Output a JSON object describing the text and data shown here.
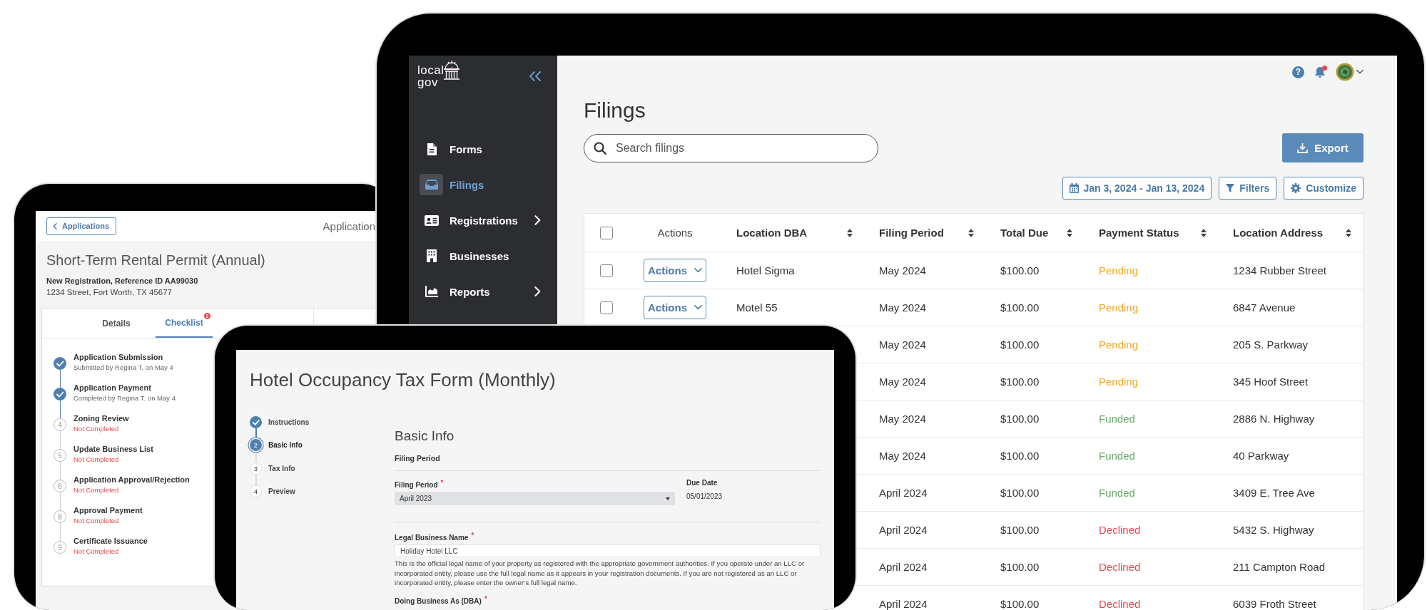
{
  "permit_app": {
    "back_button": "Applications",
    "header_title": "Application",
    "title": "Short-Term Rental Permit (Annual)",
    "subtitle": "New Registration, Reference ID AA99030",
    "address": "1234 Street, Fort Worth, TX 45677",
    "tabs": [
      {
        "label": "Details",
        "selected": false
      },
      {
        "label": "Checklist",
        "selected": true,
        "badge": "2"
      }
    ],
    "checklist": [
      {
        "title": "Application Submission",
        "status": "Submitted by Regina T. on May 4",
        "done": true
      },
      {
        "title": "Application Payment",
        "status": "Completed by Regina T. on May 4",
        "done": true
      },
      {
        "number": "4",
        "title": "Zoning Review",
        "status": "Not Completed",
        "done": false
      },
      {
        "number": "5",
        "title": "Update Business List",
        "status": "Not Completed",
        "done": false
      },
      {
        "number": "6",
        "title": "Application Approval/Rejection",
        "status": "Not Completed",
        "done": false
      },
      {
        "number": "8",
        "title": "Approval Payment",
        "status": "Not Completed",
        "done": false
      },
      {
        "number": "9",
        "title": "Certificate Issuance",
        "status": "Not Completed",
        "done": false
      }
    ]
  },
  "filings_app": {
    "logo": {
      "line_1": "local",
      "line_2": "gov"
    },
    "sidebar": {
      "items": [
        {
          "kind": "document",
          "label": "Forms",
          "selected": false,
          "expandable": false
        },
        {
          "kind": "inbox",
          "label": "Filings",
          "selected": true,
          "expandable": false
        },
        {
          "kind": "card",
          "label": "Registrations",
          "selected": false,
          "expandable": true
        },
        {
          "kind": "building",
          "label": "Businesses",
          "selected": false,
          "expandable": false
        },
        {
          "kind": "chart",
          "label": "Reports",
          "selected": false,
          "expandable": true
        }
      ]
    },
    "header": {
      "help": "?",
      "notification_unread": true
    },
    "title": "Filings",
    "search": {
      "placeholder": "Search filings"
    },
    "export_button": "Export",
    "date_range": "Jan 3, 2024 - Jan 13, 2024",
    "filters_button": "Filters",
    "customize_button": "Customize",
    "table": {
      "header_checked": false,
      "columns": [
        {
          "label": "Actions",
          "sortable": false
        },
        {
          "label": "Location DBA",
          "sortable": true
        },
        {
          "label": "Filing Period",
          "sortable": true
        },
        {
          "label": "Total Due",
          "sortable": true
        },
        {
          "label": "Payment Status",
          "sortable": true
        },
        {
          "label": "Location Address",
          "sortable": true
        }
      ],
      "rows": [
        {
          "checked": false,
          "actions": "Actions",
          "location_dba": "Hotel Sigma",
          "filing_period": "May 2024",
          "total_due": "$100.00",
          "status": {
            "text": "Pending",
            "color": "#f5a623"
          },
          "location_address": "1234 Rubber Street"
        },
        {
          "checked": false,
          "actions": "Actions",
          "location_dba": "Motel 55",
          "filing_period": "May 2024",
          "total_due": "$100.00",
          "status": {
            "text": "Pending",
            "color": "#f5a623"
          },
          "location_address": "6847 Avenue"
        },
        {
          "filing_period": "May 2024",
          "total_due": "$100.00",
          "status": {
            "text": "Pending",
            "color": "#f5a623"
          },
          "location_address": "205 S. Parkway"
        },
        {
          "filing_period": "May 2024",
          "total_due": "$100.00",
          "status": {
            "text": "Pending",
            "color": "#f5a623"
          },
          "location_address": "345 Hoof Street"
        },
        {
          "filing_period": "May 2024",
          "total_due": "$100.00",
          "status": {
            "text": "Funded",
            "color": "#6aa86a"
          },
          "location_address": "2886 N. Highway"
        },
        {
          "filing_period": "May 2024",
          "total_due": "$100.00",
          "status": {
            "text": "Funded",
            "color": "#6aa86a"
          },
          "location_address": "40 Parkway"
        },
        {
          "filing_period": "April 2024",
          "total_due": "$100.00",
          "status": {
            "text": "Funded",
            "color": "#6aa86a"
          },
          "location_address": "3409 E. Tree Ave"
        },
        {
          "filing_period": "April 2024",
          "total_due": "$100.00",
          "status": {
            "text": "Declined",
            "color": "#e8474a"
          },
          "location_address": "5432 S. Highway"
        },
        {
          "filing_period": "April 2024",
          "total_due": "$100.00",
          "status": {
            "text": "Declined",
            "color": "#e8474a"
          },
          "location_address": "211 Campton Road"
        },
        {
          "filing_period": "April 2024",
          "total_due": "$100.00",
          "status": {
            "text": "Declined",
            "color": "#e8474a"
          },
          "location_address": "6039 Froth Street"
        }
      ]
    }
  },
  "tax_form_app": {
    "title": "Hotel Occupancy Tax Form (Monthly)",
    "steps": [
      {
        "label": "Instructions",
        "done": true,
        "selected": false
      },
      {
        "number": "2",
        "label": "Basic Info",
        "done": false,
        "selected": true
      },
      {
        "number": "3",
        "label": "Tax Info",
        "done": false,
        "selected": false
      },
      {
        "number": "4",
        "label": "Preview",
        "done": false,
        "selected": false
      }
    ],
    "section_title": "Basic Info",
    "group_title": "Filing Period",
    "filing_period": {
      "label": "Filing Period",
      "required": "*",
      "value": "April 2023"
    },
    "due_date": {
      "label": "Due Date",
      "value": "05/01/2023"
    },
    "legal_name": {
      "label": "Legal Business Name",
      "required": "*",
      "value": "Holiday Hotel LLC",
      "help": "This is the official legal name of your property as registered with the appropriate government authorities. If you operate under an LLC or incorporated entity, please use the full legal name as it appears in your registration documents. If you are not registered as an LLC or incorporated entity, please enter the owner’s full legal name."
    },
    "dba": {
      "label": "Doing Business As (DBA)",
      "required": "*"
    }
  }
}
